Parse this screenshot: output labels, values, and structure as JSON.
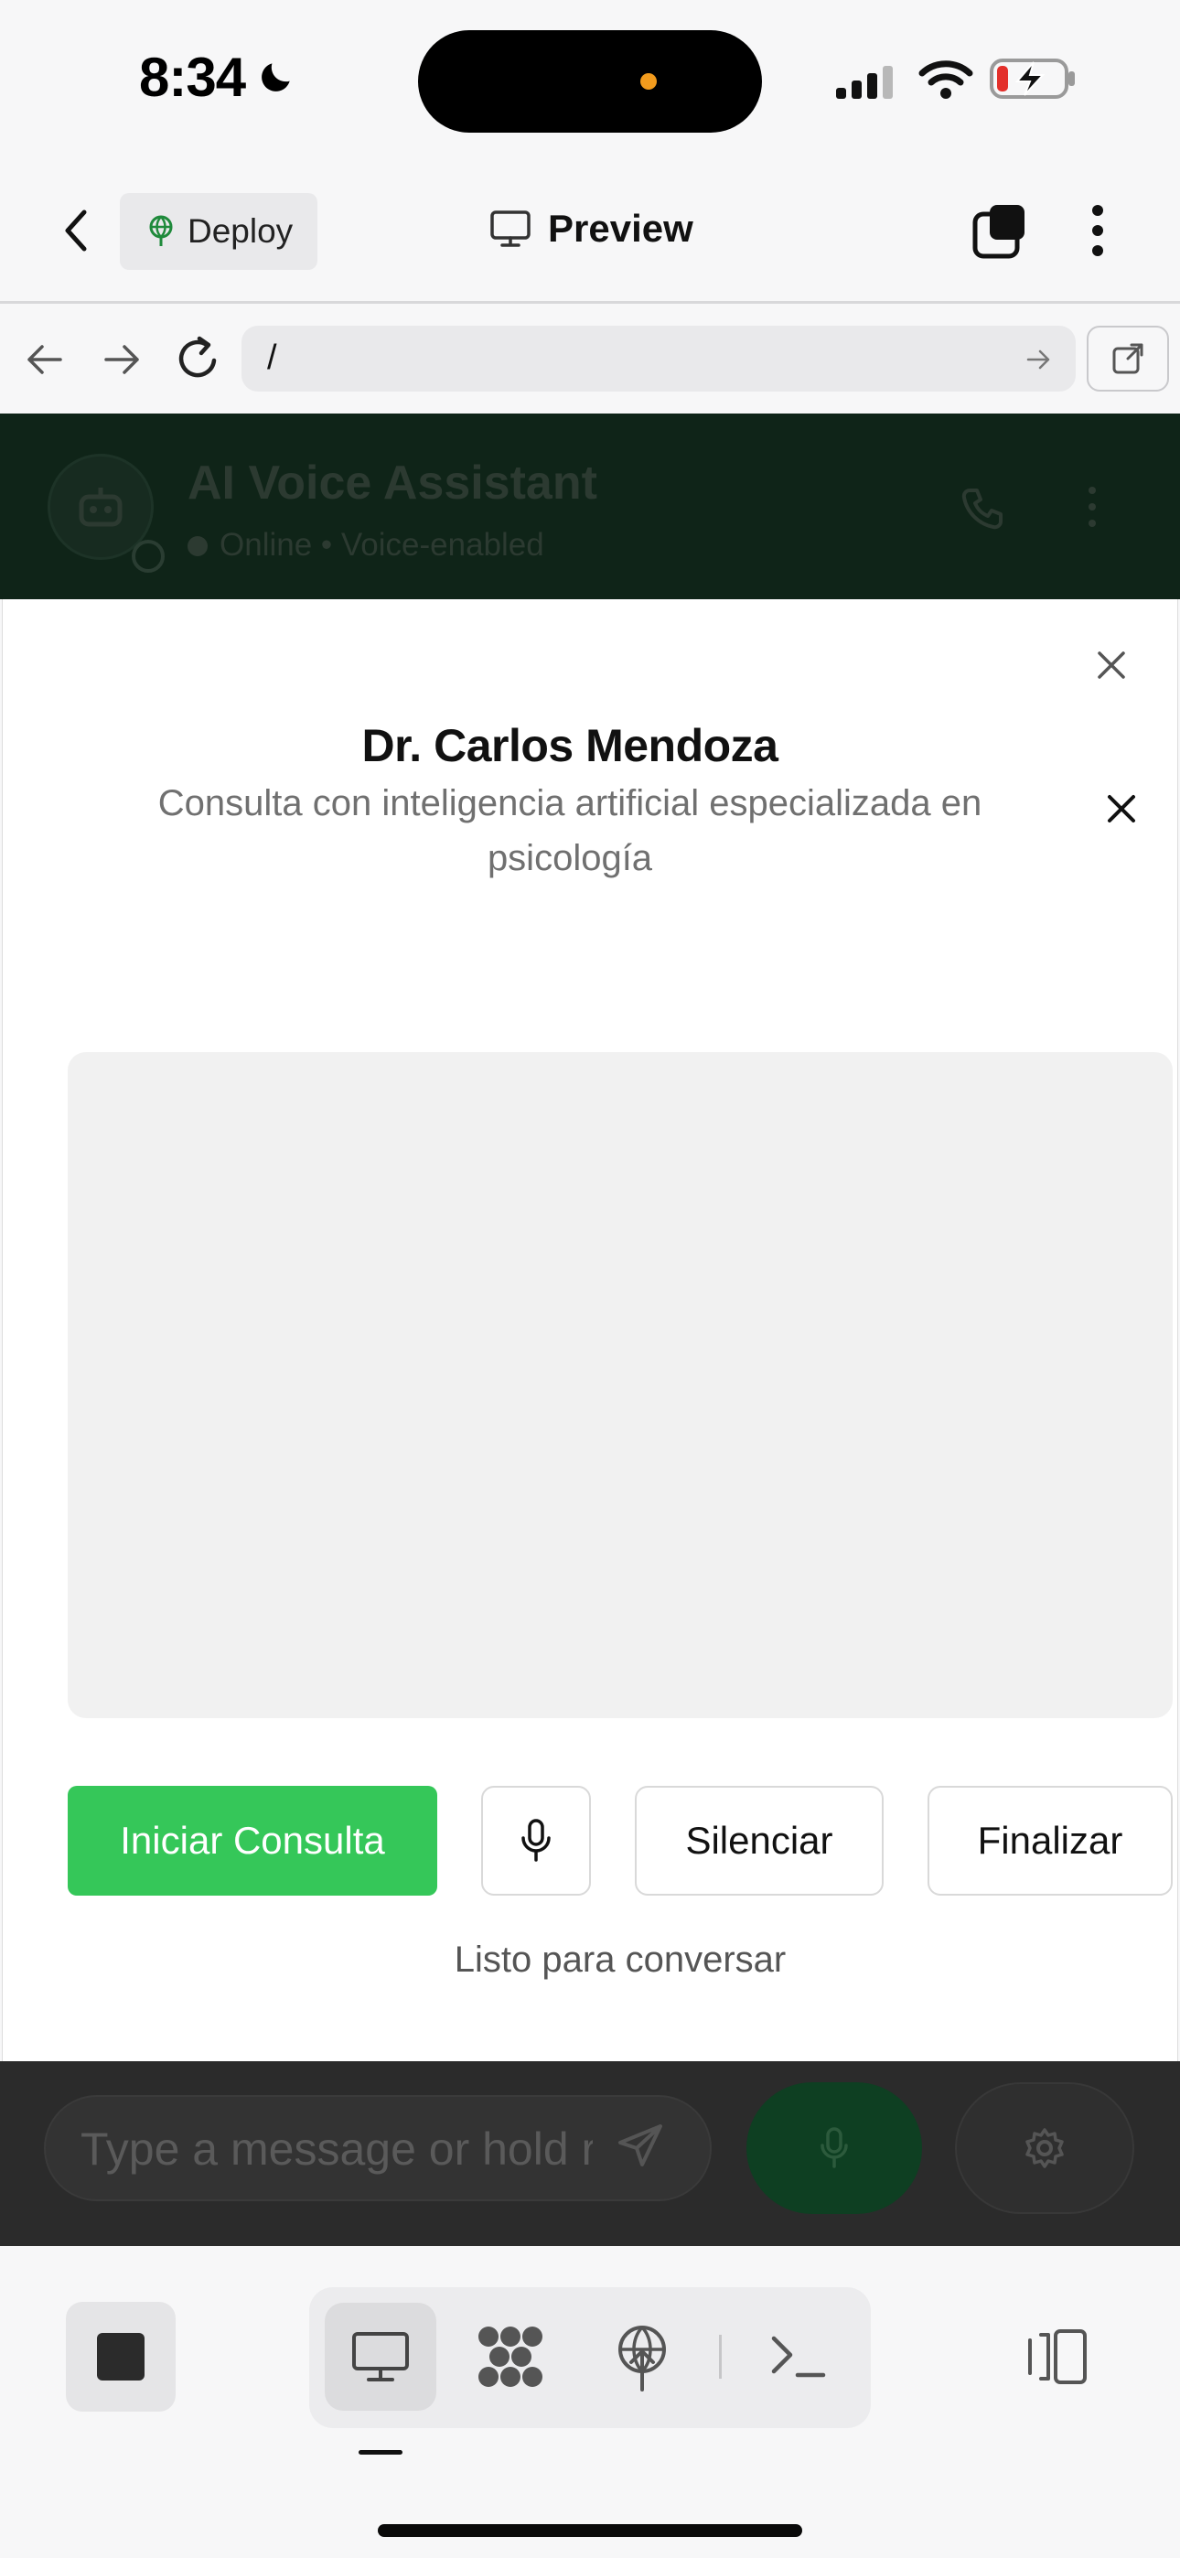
{
  "status_bar": {
    "time": "8:34",
    "icons": [
      "moon-icon",
      "signal-icon",
      "wifi-icon",
      "battery-charging-icon"
    ]
  },
  "header": {
    "deploy_label": "Deploy",
    "preview_label": "Preview",
    "icons": [
      "chevron-left-icon",
      "globe-icon",
      "monitor-icon",
      "tabs-icon",
      "more-vertical-icon"
    ]
  },
  "url_bar": {
    "url": "/",
    "icons": [
      "arrow-left-icon",
      "arrow-right-icon",
      "reload-icon",
      "arrow-go-icon",
      "external-link-icon"
    ]
  },
  "background_app": {
    "title": "AI Voice Assistant",
    "status": "Online • Voice-enabled",
    "input_placeholder": "Type a message or hold r",
    "colors": {
      "header": "#0f2418",
      "mic_button": "#0e3f22"
    }
  },
  "modal": {
    "title": "Dr. Carlos Mendoza",
    "subtitle": "Consulta con inteligencia artificial especializada en psicología",
    "buttons": {
      "start": "Iniciar Consulta",
      "mute": "Silenciar",
      "end": "Finalizar"
    },
    "status": "Listo para conversar",
    "colors": {
      "start_button": "#35c759"
    }
  },
  "toolbar": {
    "icons": [
      "stop-icon",
      "monitor-icon",
      "ai-agent-icon",
      "deploy-icon",
      "terminal-icon",
      "layout-toggle-icon"
    ],
    "active": "preview"
  }
}
